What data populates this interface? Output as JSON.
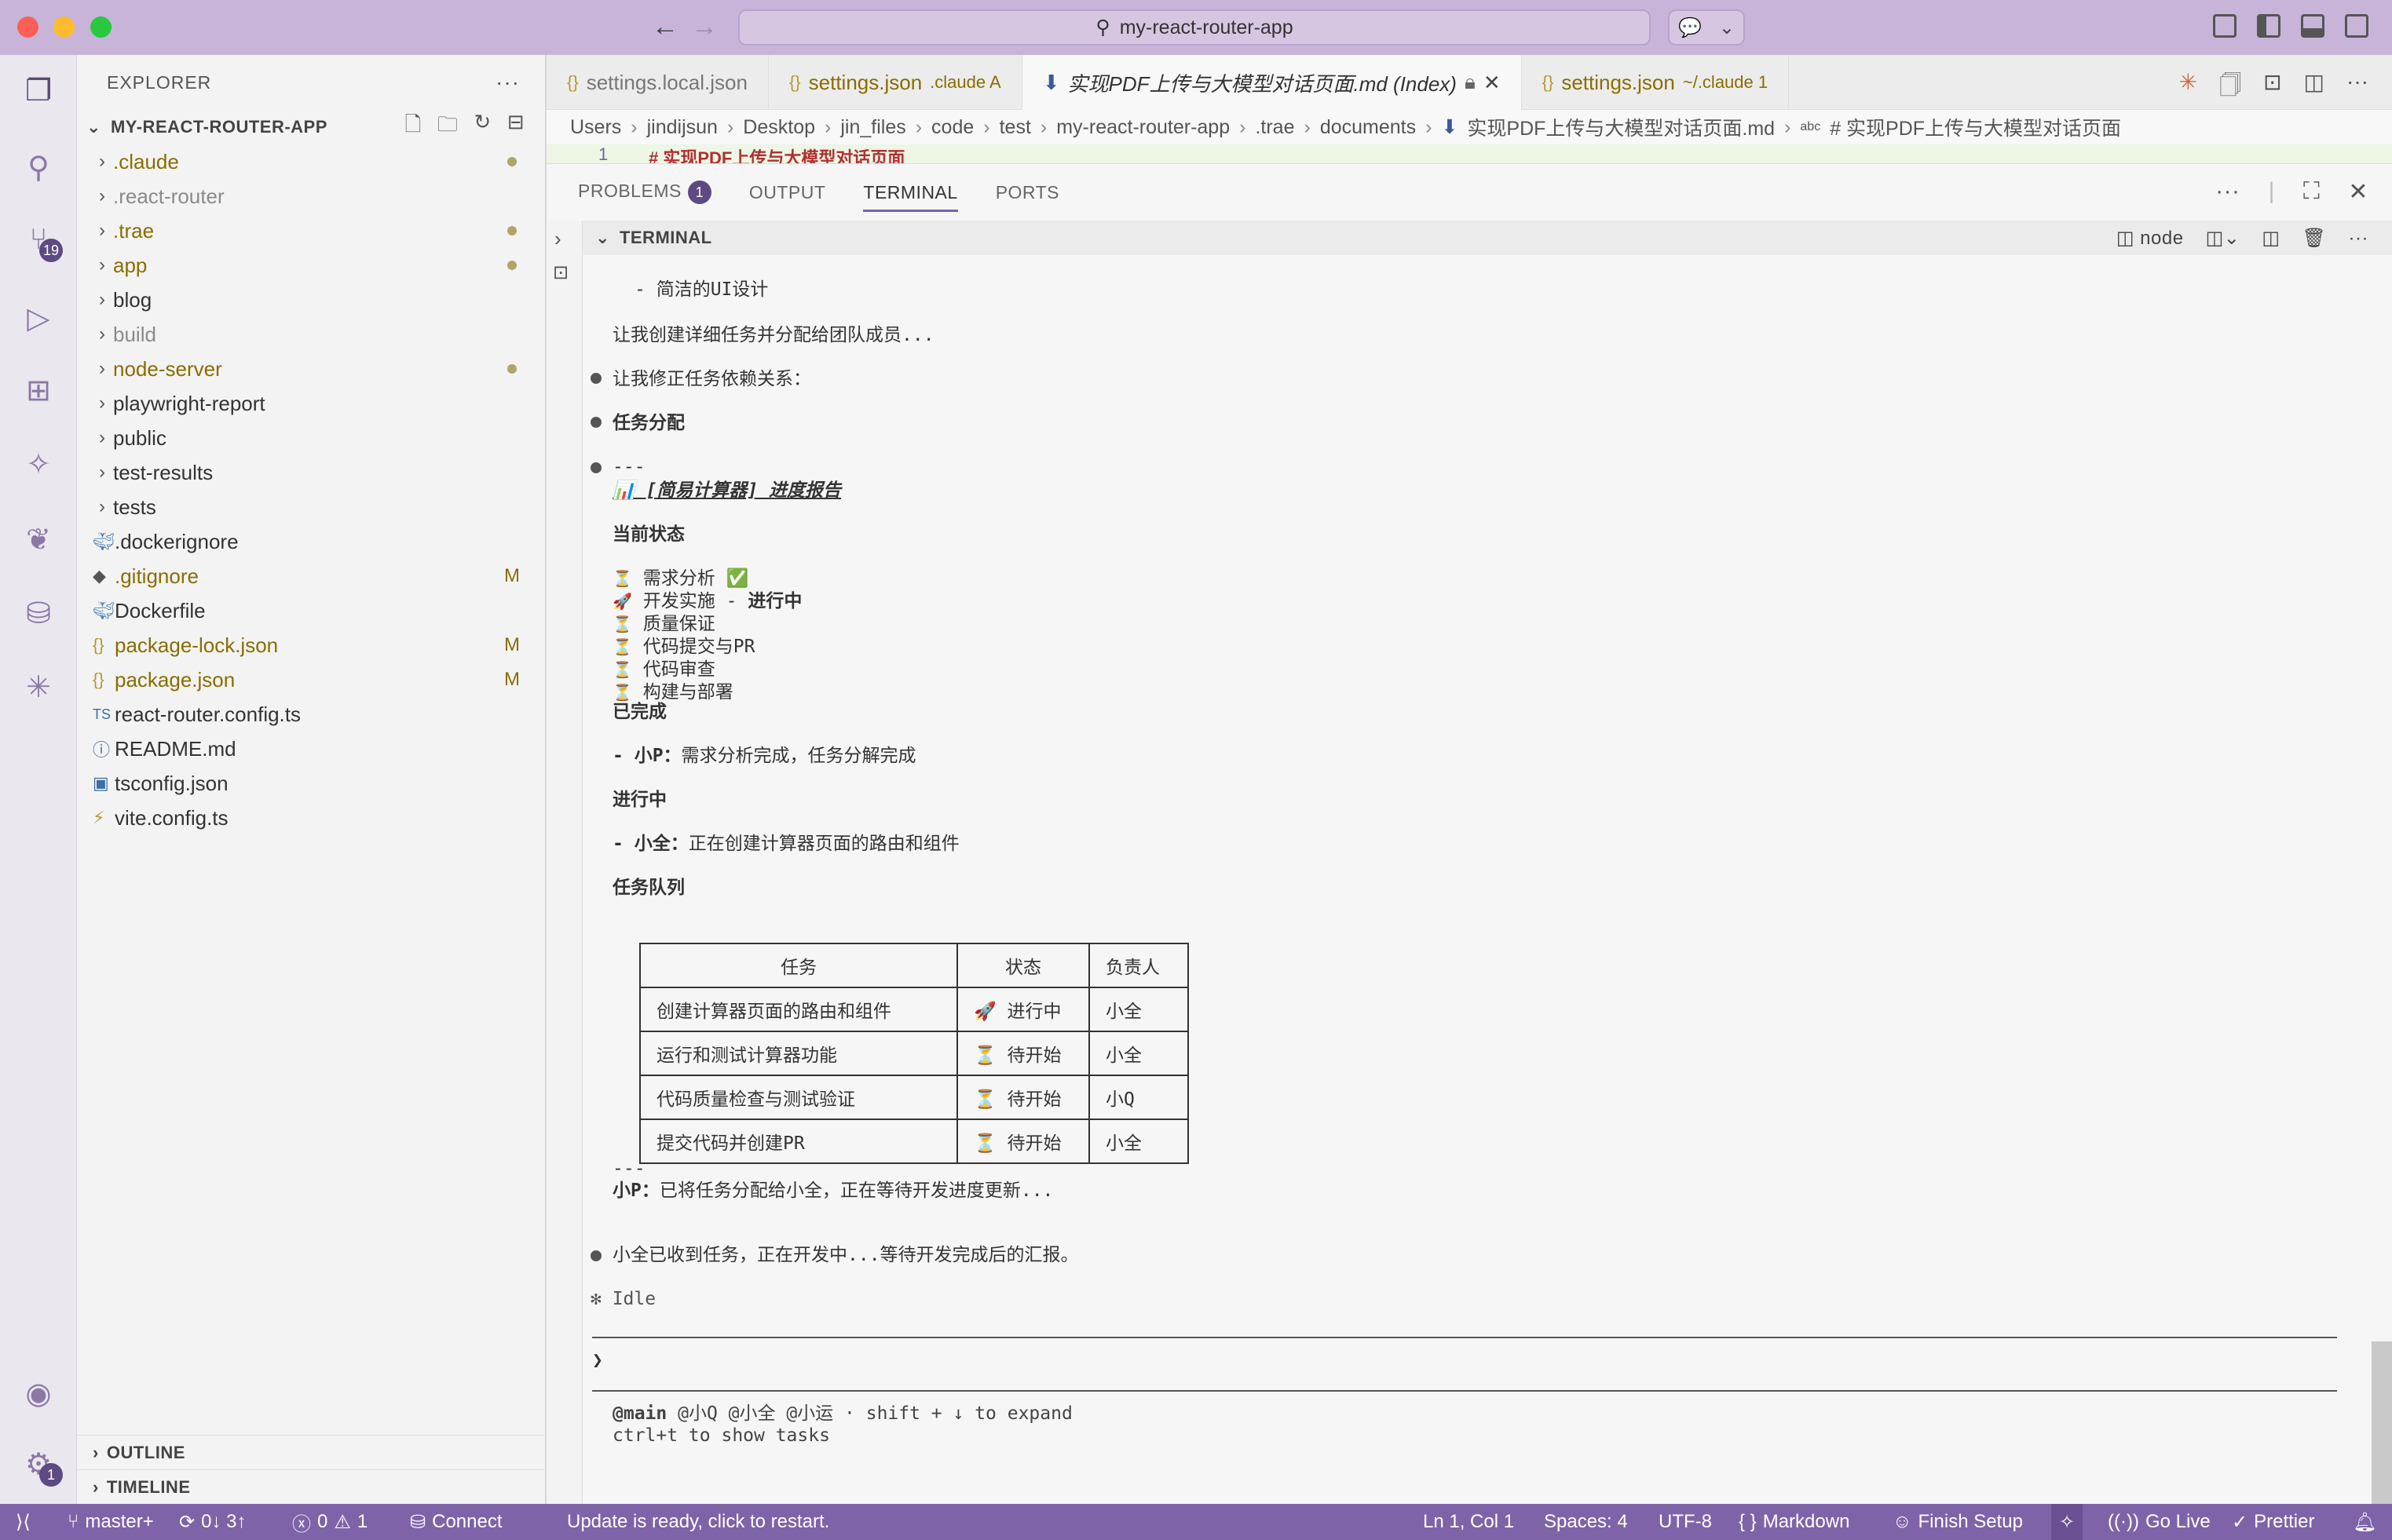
{
  "window": {
    "search_text": "my-react-router-app"
  },
  "activity_bar": {
    "scm_badge": "19",
    "settings_badge": "1"
  },
  "sidebar": {
    "title": "EXPLORER",
    "root": "MY-REACT-ROUTER-APP",
    "items": [
      {
        "name": ".claude",
        "kind": "folder"
      },
      {
        "name": ".react-router",
        "kind": "folder"
      },
      {
        "name": ".trae",
        "kind": "folder"
      },
      {
        "name": "app",
        "kind": "folder"
      },
      {
        "name": "blog",
        "kind": "folder"
      },
      {
        "name": "build",
        "kind": "folder"
      },
      {
        "name": "node-server",
        "kind": "folder"
      },
      {
        "name": "playwright-report",
        "kind": "folder"
      },
      {
        "name": "public",
        "kind": "folder"
      },
      {
        "name": "test-results",
        "kind": "folder"
      },
      {
        "name": "tests",
        "kind": "folder"
      },
      {
        "name": ".dockerignore",
        "kind": "file",
        "icon": "docker-icon"
      },
      {
        "name": ".gitignore",
        "kind": "file",
        "icon": "git-icon",
        "badge": "M"
      },
      {
        "name": "Dockerfile",
        "kind": "file",
        "icon": "docker-icon"
      },
      {
        "name": "package-lock.json",
        "kind": "file",
        "icon": "json-icon",
        "badge": "M"
      },
      {
        "name": "package.json",
        "kind": "file",
        "icon": "json-icon",
        "badge": "M"
      },
      {
        "name": "react-router.config.ts",
        "kind": "file",
        "icon": "ts-icon"
      },
      {
        "name": "README.md",
        "kind": "file",
        "icon": "info-icon"
      },
      {
        "name": "tsconfig.json",
        "kind": "file",
        "icon": "tsconfig-icon"
      },
      {
        "name": "vite.config.ts",
        "kind": "file",
        "icon": "vite-icon"
      }
    ],
    "ts_label": "TS",
    "outline": "OUTLINE",
    "timeline": "TIMELINE"
  },
  "tabs": [
    {
      "label": "settings.local.json",
      "sub": ""
    },
    {
      "label": "settings.json",
      "sub": ".claude  A"
    },
    {
      "label": "实现PDF上传与大模型对话页面.md (Index)",
      "sub": ""
    },
    {
      "label": "settings.json",
      "sub": "~/.claude  1"
    }
  ],
  "breadcrumb": [
    "Users",
    "jindijsun",
    "Desktop",
    "jin_files",
    "code",
    "test",
    "my-react-router-app",
    ".trae",
    "documents",
    "实现PDF上传与大模型对话页面.md",
    "# 实现PDF上传与大模型对话页面"
  ],
  "breadcrumb_abc": "abc",
  "editor": {
    "line_number": "1",
    "line_text": "# 实现PDF上传与大模型对话页面"
  },
  "panel": {
    "tabs": [
      "PROBLEMS",
      "OUTPUT",
      "TERMINAL",
      "PORTS"
    ],
    "problems_count": "1",
    "terminal_title": "TERMINAL",
    "terminal_name": "node"
  },
  "terminal": {
    "l1": "- 简洁的UI设计",
    "l2": "让我创建详细任务并分配给团队成员...",
    "l3": "让我修正任务依赖关系：",
    "l4": "任务分配",
    "l5": "---",
    "l6": "📊 [简易计算器] 进度报告",
    "l7": "当前状态",
    "status": [
      {
        "icon": "⏳",
        "text": "需求分析 ✅",
        "bold": ""
      },
      {
        "icon": "🚀",
        "text": "开发实施 - ",
        "bold": "进行中"
      },
      {
        "icon": "⏳",
        "text": "质量保证",
        "bold": ""
      },
      {
        "icon": "⏳",
        "text": "代码提交与PR",
        "bold": ""
      },
      {
        "icon": "⏳",
        "text": "代码审查",
        "bold": ""
      },
      {
        "icon": "⏳",
        "text": "构建与部署",
        "bold": ""
      }
    ],
    "done_title": "已完成",
    "done_who": "- 小P：",
    "done_text": "需求分析完成，任务分解完成",
    "doing_title": "进行中",
    "doing_who": "- 小全：",
    "doing_text": "正在创建计算器页面的路由和组件",
    "queue_title": "任务队列",
    "table": {
      "headers": [
        "任务",
        "状态",
        "负责人"
      ],
      "rows": [
        [
          "创建计算器页面的路由和组件",
          "🚀 进行中",
          "小全"
        ],
        [
          "运行和测试计算器功能",
          "⏳ 待开始",
          "小全"
        ],
        [
          "代码质量检查与测试验证",
          "⏳ 待开始",
          "小Q"
        ],
        [
          "提交代码并创建PR",
          "⏳ 待开始",
          "小全"
        ]
      ]
    },
    "sep": "---",
    "summary_who": "小P：",
    "summary_text": "已将任务分配给小全，正在等待开发进度更新...",
    "l_final": "小全已收到任务，正在开发中...等待开发完成后的汇报。",
    "idle": "✻ Idle",
    "prompt": "❯",
    "footer_main": "@main",
    "footer_rest": " @小Q @小全 @小运 · shift + ↓ to expand",
    "footer2": "ctrl+t to show tasks"
  },
  "statusbar": {
    "branch": "master+",
    "sync": "0↓ 3↑",
    "errors": "0",
    "warnings": "1",
    "connect": "Connect",
    "update": "Update is ready, click to restart.",
    "position": "Ln 1, Col 1",
    "spaces": "Spaces: 4",
    "encoding": "UTF-8",
    "language": "Markdown",
    "finish_setup": "Finish Setup",
    "go_live": "Go Live",
    "prettier": "Prettier"
  }
}
